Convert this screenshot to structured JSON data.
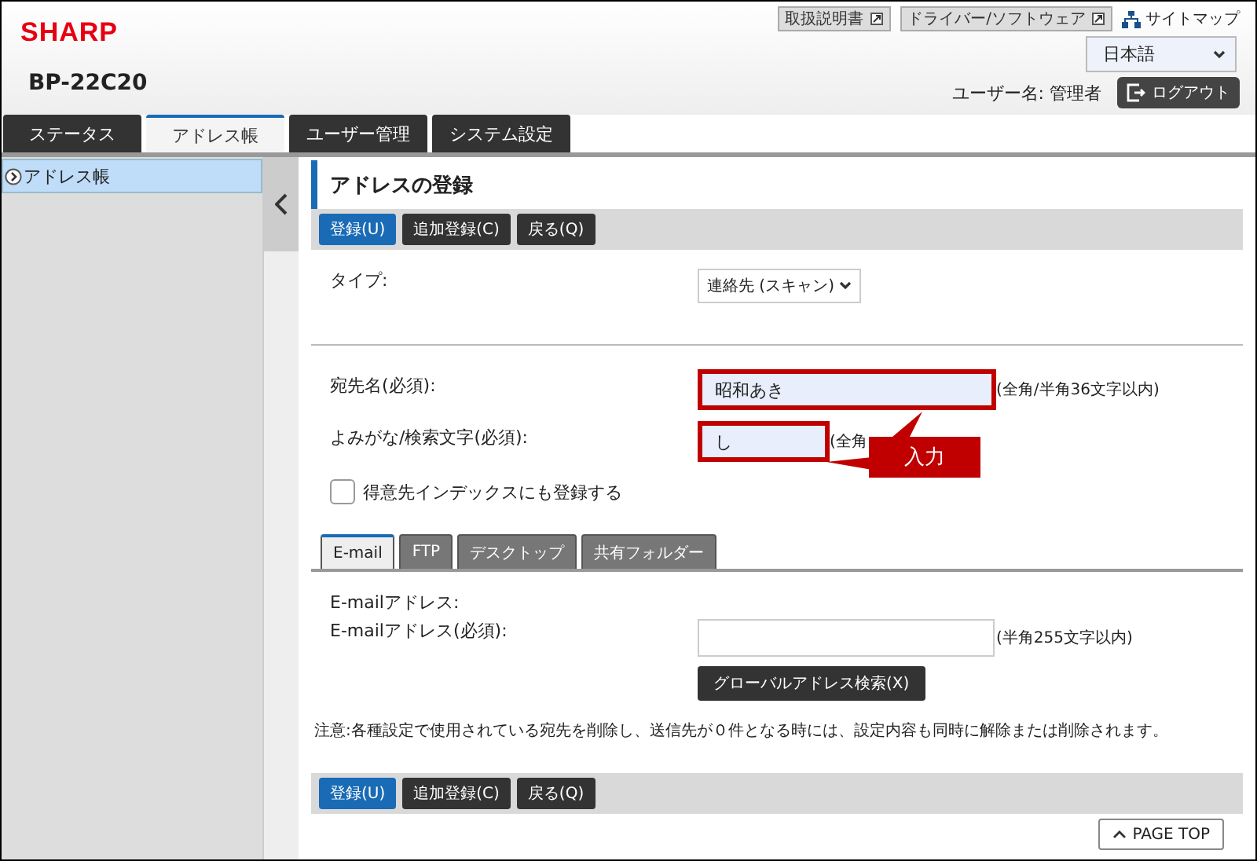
{
  "header": {
    "logo": "SHARP",
    "model": "BP-22C20",
    "links": [
      {
        "label": "取扱説明書"
      },
      {
        "label": "ドライバー/ソフトウェア"
      }
    ],
    "sitemap": "サイトマップ",
    "language": "日本語",
    "user_label": "ユーザー名: 管理者",
    "logout": "ログアウト"
  },
  "tabs": [
    {
      "label": "ステータス",
      "selected": false
    },
    {
      "label": "アドレス帳",
      "selected": true
    },
    {
      "label": "ユーザー管理",
      "selected": false
    },
    {
      "label": "システム設定",
      "selected": false
    }
  ],
  "sidebar": {
    "items": [
      {
        "label": "アドレス帳",
        "selected": true
      }
    ]
  },
  "page": {
    "title": "アドレスの登録",
    "toolbar": [
      {
        "label": "登録(U)",
        "kind": "primary"
      },
      {
        "label": "追加登録(C)",
        "kind": "dark"
      },
      {
        "label": "戻る(Q)",
        "kind": "dark"
      }
    ],
    "type_field": {
      "label": "タイプ:",
      "value": "連絡先 (スキャン)"
    },
    "fields": [
      {
        "label": "宛先名(必須):",
        "value": "昭和あき",
        "hint": "(全角/半角36文字以内)",
        "highlighted": true,
        "kind": "long"
      },
      {
        "label": "よみがな/検索文字(必須):",
        "value": "し",
        "hint": "(全角",
        "highlighted": true,
        "kind": "short"
      }
    ],
    "callout": "入力",
    "checkbox": {
      "label": "得意先インデックスにも登録する",
      "checked": false
    },
    "sub_tabs": [
      {
        "label": "E-mail",
        "selected": true
      },
      {
        "label": "FTP",
        "selected": false
      },
      {
        "label": "デスクトップ",
        "selected": false
      },
      {
        "label": "共有フォルダー",
        "selected": false
      }
    ],
    "email": {
      "heading": "E-mailアドレス:",
      "label": "E-mailアドレス(必須):",
      "hint": "(半角255文字以内)",
      "search_button": "グローバルアドレス検索(X)"
    },
    "note": "注意:各種設定で使用されている宛先を削除し、送信先が０件となる時には、設定内容も同時に解除または削除されます。",
    "bottom_toolbar": [
      {
        "label": "登録(U)",
        "kind": "primary"
      },
      {
        "label": "追加登録(C)",
        "kind": "dark"
      },
      {
        "label": "戻る(Q)",
        "kind": "dark"
      }
    ],
    "page_top": "PAGE TOP"
  }
}
